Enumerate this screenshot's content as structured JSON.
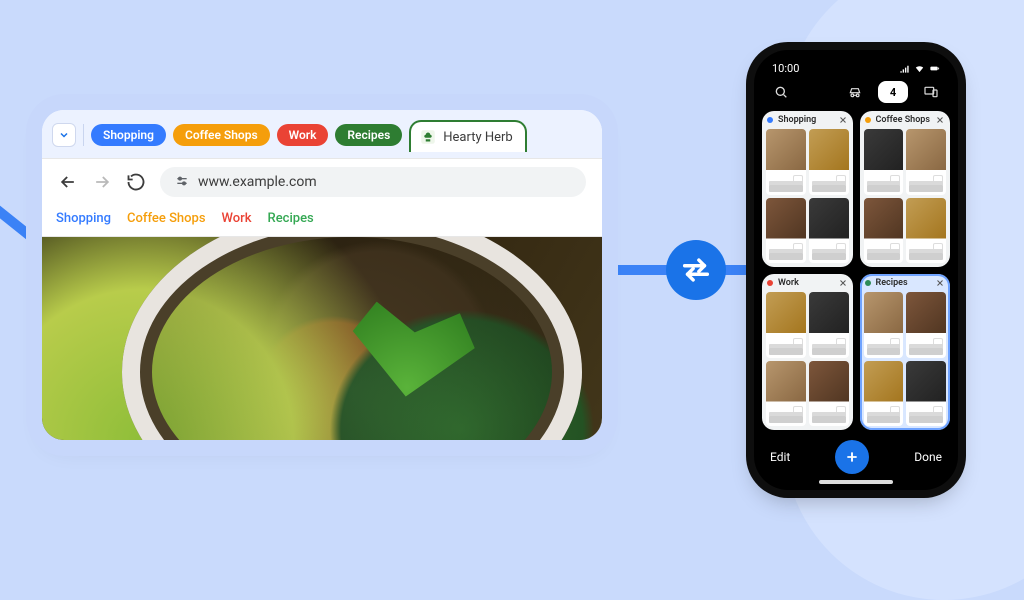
{
  "colors": {
    "blue": "#347bff",
    "orange": "#f59e0b",
    "red": "#ea4335",
    "green": "#2e7d32"
  },
  "browser": {
    "group_pills": [
      {
        "label": "Shopping",
        "color": "blue"
      },
      {
        "label": "Coffee Shops",
        "color": "orange"
      },
      {
        "label": "Work",
        "color": "red"
      },
      {
        "label": "Recipes",
        "color": "green"
      }
    ],
    "active_tab": {
      "title": "Hearty Herb"
    },
    "url": "www.example.com",
    "bookmarks": [
      {
        "label": "Shopping",
        "color": "blue"
      },
      {
        "label": "Coffee Shops",
        "color": "orange"
      },
      {
        "label": "Work",
        "color": "red"
      },
      {
        "label": "Recipes",
        "color": "green"
      }
    ]
  },
  "phone": {
    "clock": "10:00",
    "tab_count": "4",
    "groups": [
      {
        "label": "Shopping",
        "dot": "#347bff",
        "selected": false
      },
      {
        "label": "Coffee Shops",
        "dot": "#f59e0b",
        "selected": false
      },
      {
        "label": "Work",
        "dot": "#ea4335",
        "selected": false
      },
      {
        "label": "Recipes",
        "dot": "#2e8b57",
        "selected": true
      }
    ],
    "footer": {
      "edit": "Edit",
      "done": "Done"
    }
  }
}
